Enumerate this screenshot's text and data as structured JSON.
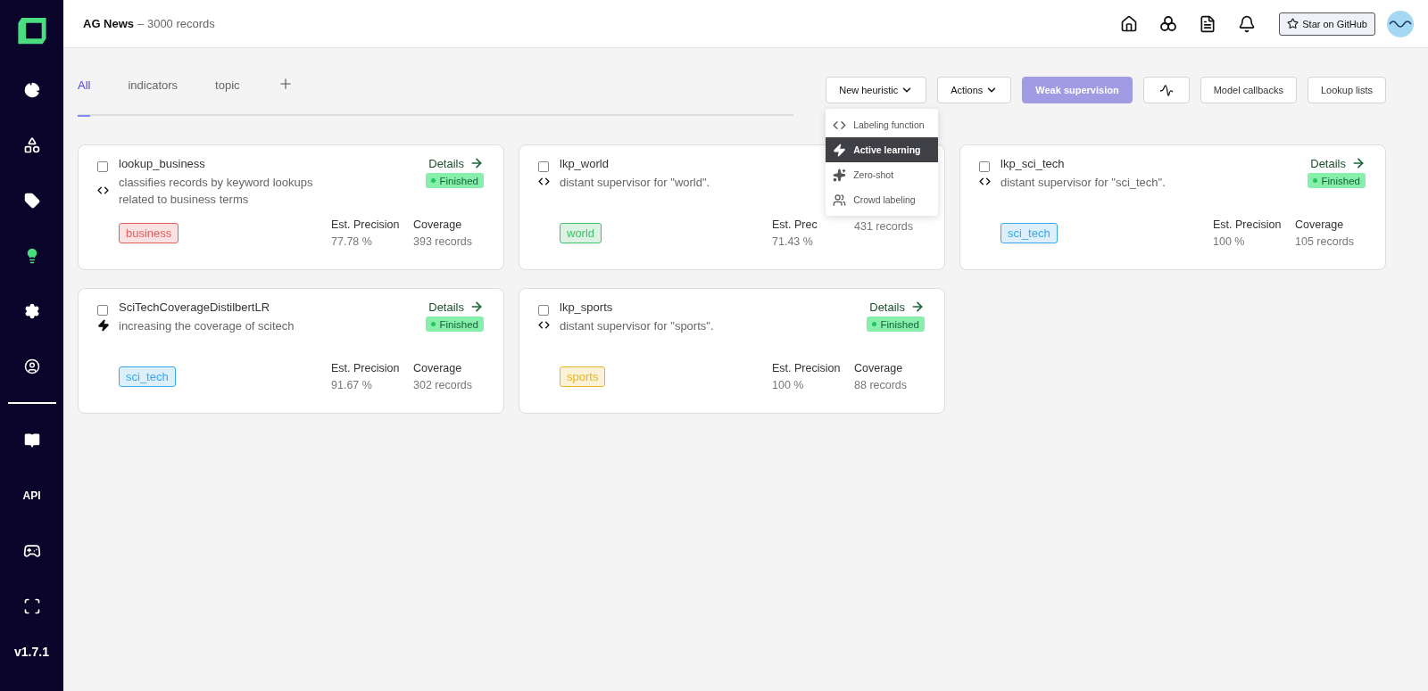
{
  "sidebar": {
    "items": [
      {
        "kind": "overview",
        "selected": false
      },
      {
        "kind": "data",
        "selected": false
      },
      {
        "kind": "labels",
        "selected": false
      },
      {
        "kind": "heuristics",
        "selected": true
      },
      {
        "kind": "settings",
        "selected": false
      },
      {
        "kind": "account",
        "selected": false
      },
      {
        "kind": "docs",
        "selected": false
      },
      {
        "kind": "api",
        "label": "API",
        "selected": false
      },
      {
        "kind": "community",
        "selected": false
      },
      {
        "kind": "fullscreen",
        "selected": false
      }
    ],
    "version": "v1.7.1"
  },
  "header": {
    "title": "AG News",
    "subtitle": "– 3000 records",
    "github_button": "Star on GitHub"
  },
  "tabs": [
    {
      "label": "All",
      "selected": true
    },
    {
      "label": "indicators",
      "selected": false
    },
    {
      "label": "topic",
      "selected": false
    }
  ],
  "toolbar": [
    {
      "kind": "dropdown",
      "label": "New heuristic"
    },
    {
      "kind": "dropdown",
      "label": "Actions"
    },
    {
      "kind": "primary",
      "label": "Weak supervision"
    },
    {
      "kind": "icon"
    },
    {
      "kind": "plain",
      "label": "Model callbacks"
    },
    {
      "kind": "plain",
      "label": "Lookup lists"
    }
  ],
  "menu": {
    "items": [
      {
        "kind": "code",
        "label": "Labeling function",
        "selected": false
      },
      {
        "kind": "active",
        "label": "Active learning",
        "selected": true
      },
      {
        "kind": "zero",
        "label": "Zero-shot",
        "selected": false
      },
      {
        "kind": "crowd",
        "label": "Crowd labeling",
        "selected": false
      }
    ]
  },
  "cards": [
    {
      "kind": "code",
      "name": "lookup_business",
      "description": "classifies records by keyword lookups related to business terms",
      "checked": false,
      "details": "Details",
      "status": "Finished",
      "tag": "business",
      "color": "#e35d5d",
      "precision_label": "Est. Precision",
      "precision": "77.78 %",
      "coverage_label": "Coverage",
      "coverage": "393 records"
    },
    {
      "kind": "code",
      "name": "lkp_world",
      "description": "distant supervisor for \"world\".",
      "checked": false,
      "tag": "world",
      "color": "#3fbf6a",
      "precision_label": "Est. Prec",
      "precision": "71.43 %",
      "coverage": "431 records"
    },
    {
      "kind": "code",
      "name": "lkp_sci_tech",
      "description": "distant supervisor for \"sci_tech\".",
      "checked": false,
      "details": "Details",
      "status": "Finished",
      "tag": "sci_tech",
      "color": "#3aa8e8",
      "precision_label": "Est. Precision",
      "precision": "100 %",
      "coverage_label": "Coverage",
      "coverage": "105 records"
    },
    {
      "kind": "active",
      "name": "SciTechCoverageDistilbertLR",
      "description": "increasing the coverage of scitech",
      "checked": false,
      "details": "Details",
      "status": "Finished",
      "tag": "sci_tech",
      "color": "#3aa8e8",
      "precision_label": "Est. Precision",
      "precision": "91.67 %",
      "coverage_label": "Coverage",
      "coverage": "302 records"
    },
    {
      "kind": "code",
      "name": "lkp_sports",
      "description": "distant supervisor for \"sports\".",
      "checked": false,
      "details": "Details",
      "status": "Finished",
      "tag": "sports",
      "color": "#e8b620",
      "precision_label": "Est. Precision",
      "precision": "100 %",
      "coverage_label": "Coverage",
      "coverage": "88 records"
    }
  ]
}
